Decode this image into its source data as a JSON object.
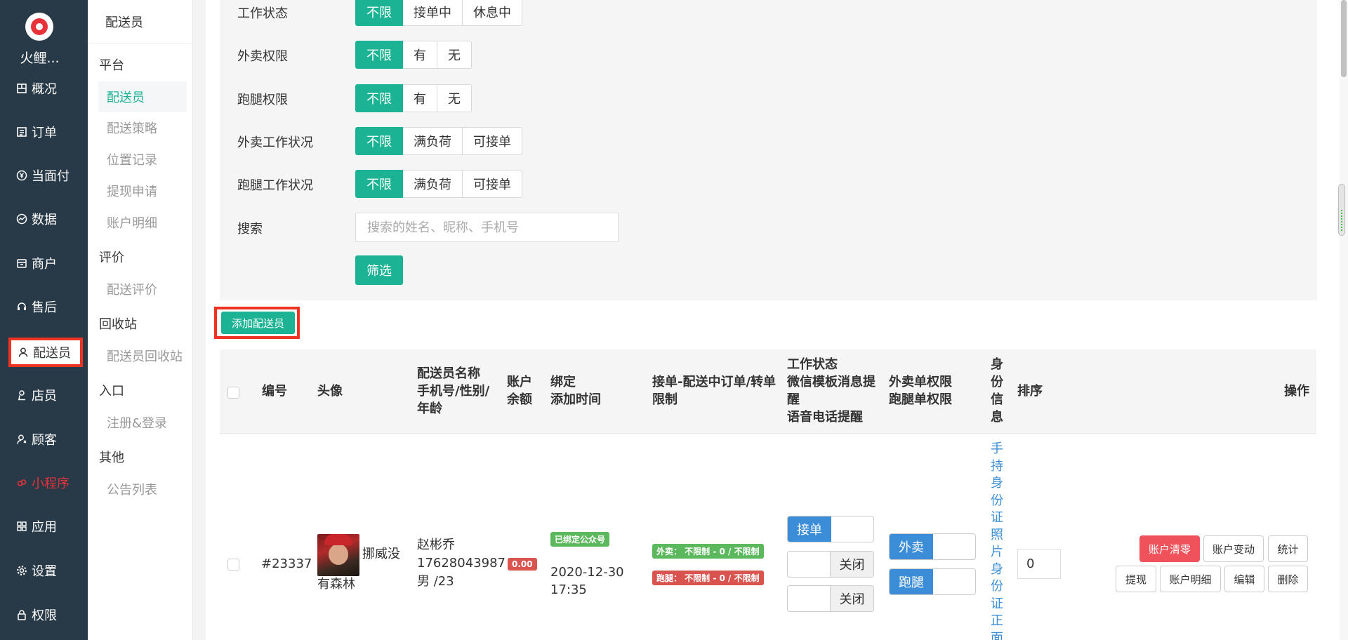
{
  "nav": {
    "brand": "火鲤...",
    "items": [
      {
        "label": "概况",
        "icon": "dashboard-icon"
      },
      {
        "label": "订单",
        "icon": "list-icon"
      },
      {
        "label": "当面付",
        "icon": "yen-icon"
      },
      {
        "label": "数据",
        "icon": "chart-icon"
      },
      {
        "label": "商户",
        "icon": "store-icon"
      },
      {
        "label": "售后",
        "icon": "headset-icon"
      },
      {
        "label": "配送员",
        "icon": "user-icon"
      },
      {
        "label": "店员",
        "icon": "person-icon"
      },
      {
        "label": "顾客",
        "icon": "customer-icon"
      },
      {
        "label": "小程序",
        "icon": "miniprogram-icon"
      },
      {
        "label": "应用",
        "icon": "apps-icon"
      },
      {
        "label": "设置",
        "icon": "gear-icon"
      },
      {
        "label": "权限",
        "icon": "lock-icon"
      }
    ],
    "active": "配送员",
    "highlight_color": "#e8323a"
  },
  "sub": {
    "title": "配送员",
    "groups": {
      "platform": "平台",
      "review": "评价",
      "recycle": "回收站",
      "entry": "入口",
      "other": "其他"
    },
    "items": {
      "courier": "配送员",
      "strategy": "配送策略",
      "location": "位置记录",
      "withdraw": "提现申请",
      "account": "账户明细",
      "review": "配送评价",
      "recycle": "配送员回收站",
      "register": "注册&登录",
      "notice": "公告列表"
    }
  },
  "filters": {
    "work_status": {
      "label": "工作状态",
      "options": [
        "不限",
        "接单中",
        "休息中"
      ],
      "selected": "不限"
    },
    "takeout_perm": {
      "label": "外卖权限",
      "options": [
        "不限",
        "有",
        "无"
      ],
      "selected": "不限"
    },
    "errand_perm": {
      "label": "跑腿权限",
      "options": [
        "不限",
        "有",
        "无"
      ],
      "selected": "不限"
    },
    "takeout_load": {
      "label": "外卖工作状况",
      "options": [
        "不限",
        "满负荷",
        "可接单"
      ],
      "selected": "不限"
    },
    "errand_load": {
      "label": "跑腿工作状况",
      "options": [
        "不限",
        "满负荷",
        "可接单"
      ],
      "selected": "不限"
    },
    "search": {
      "label": "搜索",
      "placeholder": "搜索的姓名、昵称、手机号",
      "value": ""
    },
    "submit": "筛选"
  },
  "add_button": "添加配送员",
  "table": {
    "headers": {
      "id": "编号",
      "avatar": "头像",
      "name": [
        "配送员名称",
        "手机号/性别/",
        "年龄"
      ],
      "balance": [
        "账户",
        "余额"
      ],
      "bind": [
        "绑定",
        "添加时间"
      ],
      "limit": [
        "接单-配送中订单/转单",
        "限制"
      ],
      "status": [
        "工作状态",
        "微信模板消息提",
        "醒",
        "语音电话提醒"
      ],
      "perm": [
        "外卖单权限",
        "跑腿单权限"
      ],
      "idinfo": [
        "身",
        "份",
        "信",
        "息"
      ],
      "sort": "排序",
      "ops": "操作"
    },
    "rows": [
      {
        "id": "#23337",
        "nickname_1": "挪威没",
        "nickname_2": "有森林",
        "name": "赵彬乔",
        "phone": "17628043987",
        "gender_age": "男 /23",
        "balance": "0.00",
        "bind_badge": "已绑定公众号",
        "date": "2020-12-30",
        "time": "17:35",
        "limit_takeout": "外卖： 不限制 - 0 / 不限制",
        "limit_errand": "跑腿： 不限制 - 0 / 不限制",
        "toggle_accept": "接单",
        "toggle_wechat": "关闭",
        "toggle_voice": "关闭",
        "perm_takeout": "外卖",
        "perm_errand": "跑腿",
        "idinfo": "手持身份证照片身份证正面",
        "sort": "0",
        "actions": {
          "clear": "账户清零",
          "change": "账户变动",
          "stats": "统计",
          "withdraw": "提现",
          "detail": "账户明细",
          "edit": "编辑",
          "delete": "删除"
        }
      }
    ]
  },
  "colors": {
    "primary": "#1bb394",
    "nav_bg": "#283a47",
    "toggle_blue": "#3c8dd8",
    "danger": "#f0525b",
    "badge_green": "#5cb85c",
    "badge_red": "#d9534f"
  }
}
